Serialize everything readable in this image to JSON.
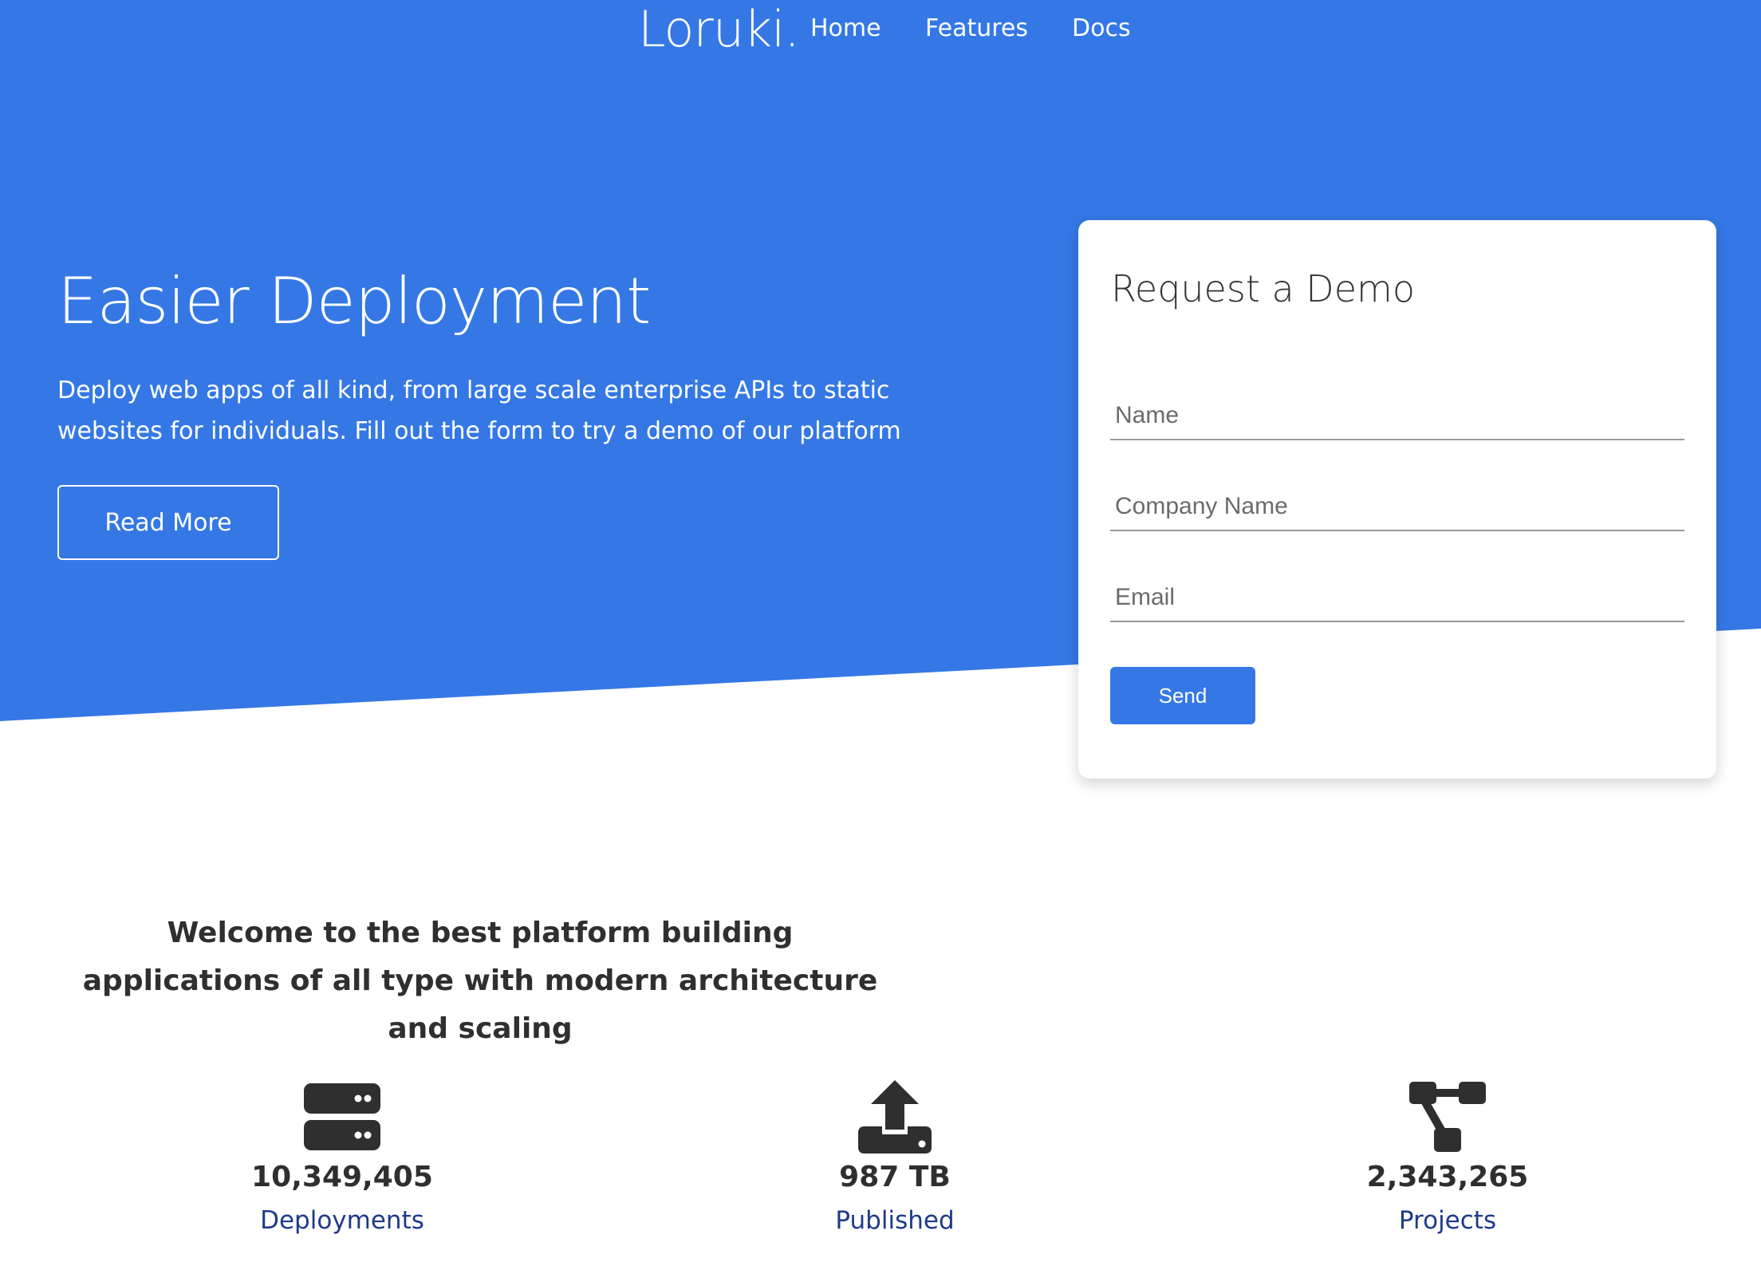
{
  "nav": {
    "brand": "Loruki.",
    "links": [
      {
        "label": "Home"
      },
      {
        "label": "Features"
      },
      {
        "label": "Docs"
      }
    ]
  },
  "hero": {
    "title": "Easier Deployment",
    "description": "Deploy web apps of all kind, from large scale enterprise APIs to static websites for individuals. Fill out the form to try a demo of our platform",
    "read_more_label": "Read More"
  },
  "demo_form": {
    "title": "Request a Demo",
    "name_placeholder": "Name",
    "company_placeholder": "Company Name",
    "email_placeholder": "Email",
    "send_label": "Send"
  },
  "stats_section": {
    "heading": "Welcome to the best platform building applications of all type with modern architecture and scaling",
    "items": [
      {
        "icon": "server-icon",
        "value": "10,349,405",
        "label": "Deployments"
      },
      {
        "icon": "upload-icon",
        "value": "987 TB",
        "label": "Published"
      },
      {
        "icon": "project-diagram-icon",
        "value": "2,343,265",
        "label": "Projects"
      }
    ]
  },
  "colors": {
    "primary": "#3578e5",
    "stat_label": "#1e3a8a",
    "text": "#2f2f2f"
  }
}
